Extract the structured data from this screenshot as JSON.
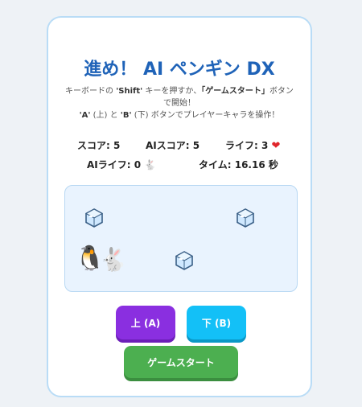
{
  "title": "進め！ AI ペンギン DX",
  "instructions": {
    "line1_pre": "キーボードの ",
    "shift_key": "'Shift'",
    "line1_mid": " キーを押すか、",
    "start_quote": "「ゲームスタート」",
    "line1_post": "ボタンで開始！",
    "a_key": "'A'",
    "a_desc": " (上) と ",
    "b_key": "'B'",
    "b_desc": " (下) ボタンでプレイヤーキャラを操作！"
  },
  "stats": {
    "score": "スコア: 5",
    "ai_score": "AIスコア: 5",
    "lives": "ライフ: 3",
    "ai_lives": "AIライフ: 0",
    "time": "タイム: 16.16 秒"
  },
  "icons": {
    "heart": "heart-icon",
    "rabbit_small": "rabbit-icon",
    "ice": "ice-cube-icon",
    "penguin": "penguin-icon",
    "rabbit": "rabbit-icon"
  },
  "buttons": {
    "up": "上 (A)",
    "down": "下 (B)",
    "start": "ゲームスタート"
  },
  "colors": {
    "title": "#1f63b8",
    "up_button": "#8a2fe0",
    "down_button": "#13c0f7",
    "start_button": "#4caf50",
    "heart": "#e0252b"
  }
}
